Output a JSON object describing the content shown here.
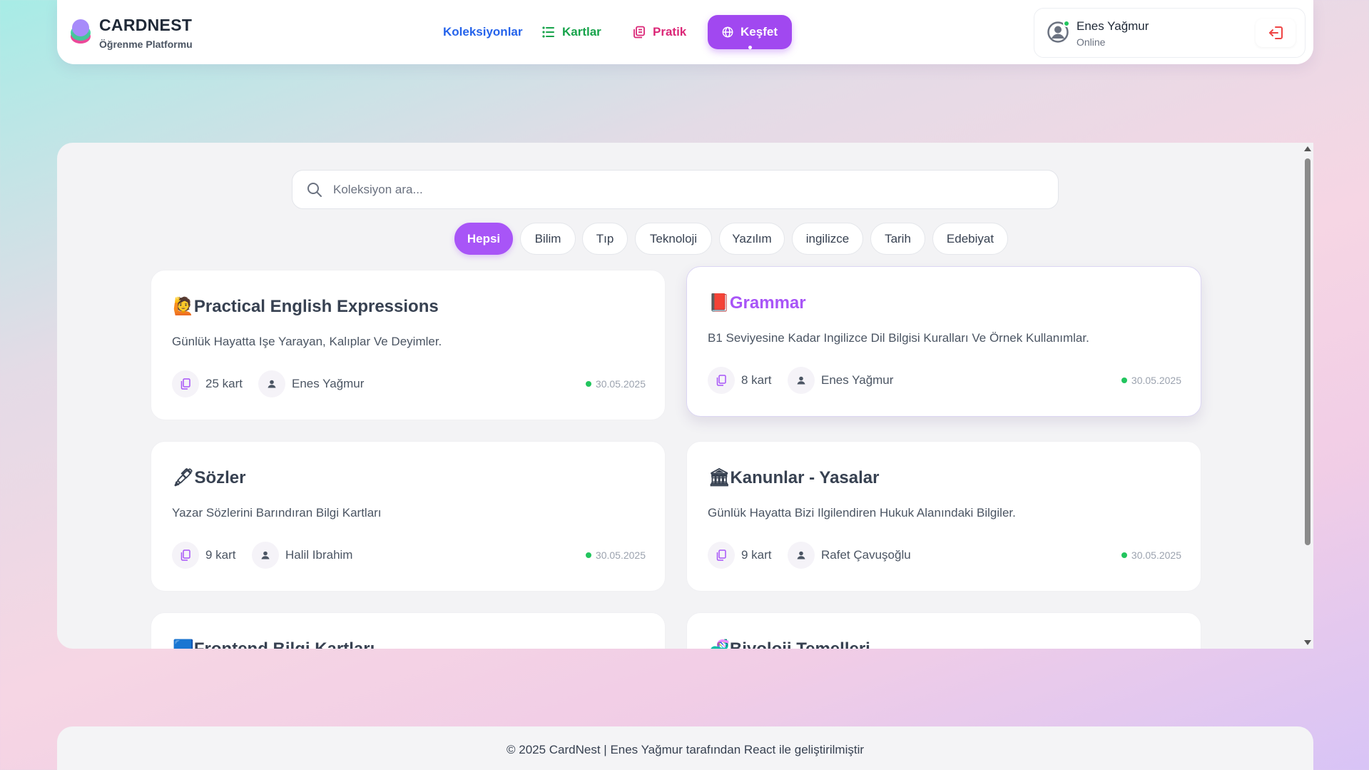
{
  "header": {
    "brand_name": "CARDNEST",
    "brand_sub": "Öğrenme Platformu",
    "nav": [
      {
        "label": "Koleksiyonlar",
        "icon": "book-icon",
        "color": "#2563eb"
      },
      {
        "label": "Kartlar",
        "icon": "list-icon",
        "color": "#16a34a"
      },
      {
        "label": "Pratik",
        "icon": "cards-icon",
        "color": "#db2777"
      },
      {
        "label": "Keşfet",
        "icon": "globe-icon",
        "color": "#a148f0",
        "active": true
      }
    ],
    "user": {
      "name": "Enes Yağmur",
      "status": "Online",
      "logout_icon": "logout-icon"
    }
  },
  "search": {
    "placeholder": "Koleksiyon ara..."
  },
  "filters": [
    {
      "label": "Hepsi",
      "active": true
    },
    {
      "label": "Bilim"
    },
    {
      "label": "Tıp"
    },
    {
      "label": "Teknoloji"
    },
    {
      "label": "Yazılım"
    },
    {
      "label": "ingilizce"
    },
    {
      "label": "Tarih"
    },
    {
      "label": "Edebiyat"
    }
  ],
  "cards": [
    {
      "emoji": "🙋",
      "title": "Practical English Expressions",
      "description": "Günlük Hayatta Işe Yarayan, Kalıplar Ve Deyimler.",
      "count": "25 kart",
      "author": "Enes Yağmur",
      "date": "30.05.2025"
    },
    {
      "emoji": "📕",
      "title": "Grammar",
      "description": "B1 Seviyesine Kadar Ingilizce Dil Bilgisi Kuralları Ve Örnek Kullanımlar.",
      "count": "8 kart",
      "author": "Enes Yağmur",
      "date": "30.05.2025"
    },
    {
      "emoji": "🖋",
      "title": "Sözler",
      "description": "Yazar Sözlerini Barındıran Bilgi Kartları",
      "count": "9 kart",
      "author": "Halil Ibrahim",
      "date": "30.05.2025"
    },
    {
      "emoji": "🏛",
      "title": "Kanunlar - Yasalar",
      "description": "Günlük Hayatta Bizi Ilgilendiren Hukuk Alanındaki Bilgiler.",
      "count": "9 kart",
      "author": "Rafet Çavuşoğlu",
      "date": "30.05.2025"
    },
    {
      "emoji": "🟦",
      "title": "Frontend Bilgi Kartları"
    },
    {
      "emoji": "🧬",
      "title": "Biyoloji Temelleri"
    }
  ],
  "footer": {
    "text": "© 2025 CardNest | Enes Yağmur tarafından React ile geliştirilmiştir"
  }
}
